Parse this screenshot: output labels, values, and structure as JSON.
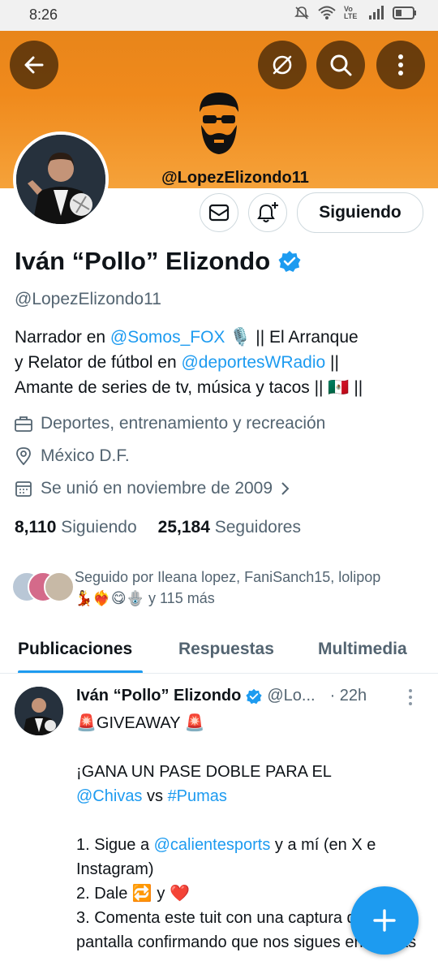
{
  "status": {
    "time": "8:26",
    "net": "Vo LTE"
  },
  "profile": {
    "banner_handle": "@LopezElizondo11",
    "name": "Iván “Pollo” Elizondo",
    "handle": "@LopezElizondo11",
    "bio": {
      "line1_pre": "Narrador en ",
      "line1_link": "@Somos_FOX",
      "line1_post": " 🎙️ || El Arranque",
      "line2_pre": "y Relator de fútbol en ",
      "line2_link": "@deportesWRadio",
      "line2_post": " ||",
      "line3": "Amante de series de tv, música y tacos || 🇲🇽 ||"
    },
    "category": "Deportes, entrenamiento y recreación",
    "location": "México D.F.",
    "joined": "Se unió en noviembre de 2009",
    "following_count": "8,110",
    "following_label": "Siguiendo",
    "followers_count": "25,184",
    "followers_label": "Seguidores",
    "followed_by_line1": "Seguido por Ileana lopez, FaniSanch15, lolipop",
    "followed_by_line2": "💃❤️‍🔥😋🪬 y 115 más",
    "follow_button": "Siguiendo"
  },
  "tabs": [
    "Publicaciones",
    "Respuestas",
    "Multimedia"
  ],
  "tweet": {
    "name": "Iván “Pollo” Elizondo",
    "handle": "@Lo...",
    "time": "· 22h",
    "line1": "🚨GIVEAWAY 🚨",
    "line2": "¡GANA UN PASE DOBLE PARA EL",
    "line3_link1": "@Chivas",
    "line3_mid": " vs ",
    "line3_link2": "#Pumas",
    "line4_pre": "1. Sigue a ",
    "line4_link": "@calientesports",
    "line4_post": " y a mí (en X e Instagram)",
    "line5": "2. Dale 🔁 y ❤️",
    "line6": "3. Comenta este tuit con una captura de pantalla confirmando que nos sigues en ambas"
  },
  "colors": {
    "accent": "#1d9bf0",
    "banner": "#f08a1c"
  }
}
